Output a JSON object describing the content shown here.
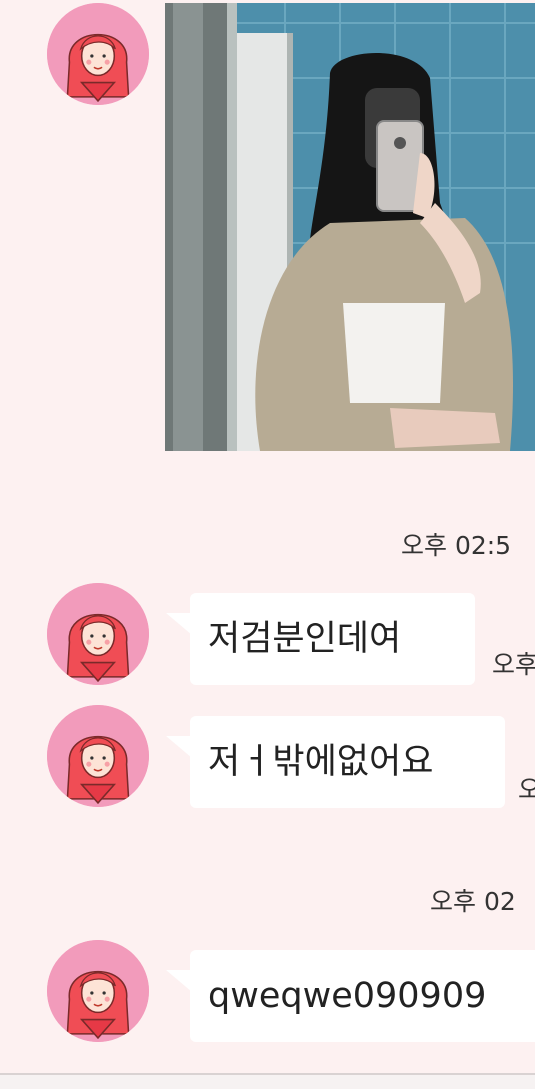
{
  "messages": [
    {
      "type": "photo",
      "alt": ""
    },
    {
      "type": "time_separator",
      "text": "오후 02:5"
    },
    {
      "type": "text",
      "text": "저검분인데여",
      "time": "오후"
    },
    {
      "type": "text",
      "text": "저ㅓ밖에없어요",
      "time": "오"
    },
    {
      "type": "time_separator",
      "text": "오후 02"
    },
    {
      "type": "text",
      "text": "qweqwe090909"
    }
  ],
  "colors": {
    "background": "#fdf1f1",
    "bubble": "#ffffff",
    "avatar_bg": "#f29bbb",
    "avatar_hair": "#f04d55"
  },
  "icons": [
    "avatar-girl-icon"
  ]
}
